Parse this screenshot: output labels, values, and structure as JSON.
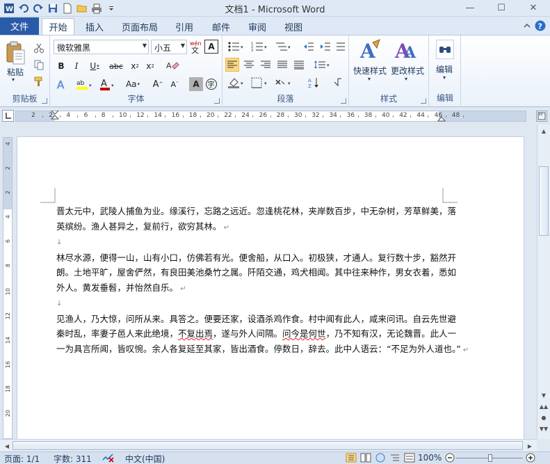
{
  "window": {
    "title": "文档1 - Microsoft Word",
    "minimize": "—",
    "maximize": "☐",
    "close": "✕"
  },
  "tabs": {
    "file": "文件",
    "items": [
      "开始",
      "插入",
      "页面布局",
      "引用",
      "邮件",
      "审阅",
      "视图"
    ],
    "active": "开始"
  },
  "ribbon": {
    "clipboard": {
      "label": "剪贴板",
      "paste": "粘贴"
    },
    "font": {
      "label": "字体",
      "font_name": "微软雅黑",
      "font_size": "小五"
    },
    "paragraph": {
      "label": "段落"
    },
    "styles": {
      "label": "样式",
      "quick_styles": "快速样式",
      "change_styles": "更改样式"
    },
    "editing": {
      "label": "编辑",
      "edit": "编辑"
    }
  },
  "ruler": {
    "numbers": [
      "2",
      "2",
      "4",
      "6",
      "8",
      "10",
      "12",
      "14",
      "16",
      "18",
      "20",
      "22",
      "24",
      "26",
      "28",
      "30",
      "32",
      "34",
      "36",
      "38",
      "40",
      "42",
      "44",
      "46",
      "48"
    ]
  },
  "vruler": {
    "numbers": [
      "4",
      "2",
      "2",
      "4",
      "6",
      "8",
      "10",
      "12",
      "14",
      "16",
      "18",
      "20"
    ]
  },
  "document": {
    "paragraphs": [
      {
        "lines": [
          "晋太元中，武陵人捕鱼为业。缘溪行，忘路之远近。忽逢桃花林，夹岸数百步，中无杂树，芳草鲜美，落",
          "英缤纷。渔人甚异之，复前行，欲穷其林。"
        ]
      },
      {
        "lines": [
          "林尽水源，便得一山，山有小口，仿佛若有光。便舍船，从口入。初极狭，才通人。复行数十步，豁然开",
          "朗。土地平旷，屋舍俨然，有良田美池桑竹之属。阡陌交通，鸡犬相闻。其中往来种作，男女衣着，悉如",
          "外人。黄发垂髫，并怡然自乐。"
        ]
      },
      {
        "lines": [
          "见渔人，乃大惊，问所从来。具答之。便要还家，设酒杀鸡作食。村中闻有此人，咸来问讯。自云先世避",
          "秦时乱，率妻子邑人来此绝境，不复出焉，遂与外人间隔。问今是何世，乃不知有汉，无论魏晋。此人一",
          "一为具言所闻，皆叹惋。余人各复延至其家，皆出酒食。停数日，辞去。此中人语云：“不足为外人道也。”"
        ]
      }
    ],
    "paragraph_mark": "↵",
    "empty_mark": "↓"
  },
  "status": {
    "page": "页面: 1/1",
    "words": "字数: 311",
    "language": "中文(中国)",
    "zoom": "100%"
  }
}
